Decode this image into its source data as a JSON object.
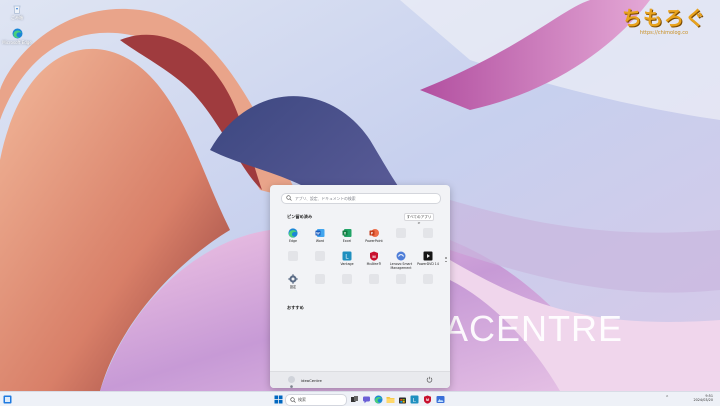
{
  "desktop": {
    "icons": [
      {
        "label": "ごみ箱",
        "icon": "recycle-bin-icon"
      },
      {
        "label": "Microsoft Edge",
        "icon": "edge-icon"
      }
    ],
    "brand_text": "ACENTRE",
    "watermark": {
      "title": "ちもろぐ",
      "url": "https://chimolog.co"
    }
  },
  "start_menu": {
    "search_placeholder": "アプリ、設定、ドキュメントの検索",
    "pinned_title": "ピン留め済み",
    "all_apps_label": "すべてのアプリ >",
    "pinned_apps": [
      {
        "label": "Edge",
        "icon": "edge-icon"
      },
      {
        "label": "Word",
        "icon": "word-icon"
      },
      {
        "label": "Excel",
        "icon": "excel-icon"
      },
      {
        "label": "PowerPoint",
        "icon": "powerpoint-icon"
      },
      {
        "label": "",
        "icon": "placeholder"
      },
      {
        "label": "",
        "icon": "placeholder"
      },
      {
        "label": "",
        "icon": "placeholder"
      },
      {
        "label": "",
        "icon": "placeholder"
      },
      {
        "label": "Vantage",
        "icon": "lenovo-vantage-icon"
      },
      {
        "label": "McAfee®",
        "icon": "mcafee-icon"
      },
      {
        "label": "Lenovo Smart Management",
        "icon": "lenovo-smart-icon"
      },
      {
        "label": "PowerDVD 14",
        "icon": "powerdvd-icon"
      },
      {
        "label": "設定",
        "icon": "settings-icon"
      },
      {
        "label": "",
        "icon": "placeholder"
      },
      {
        "label": "",
        "icon": "placeholder"
      },
      {
        "label": "",
        "icon": "placeholder"
      },
      {
        "label": "",
        "icon": "placeholder"
      },
      {
        "label": "",
        "icon": "placeholder"
      }
    ],
    "recommended_title": "おすすめ",
    "user_name": "ideaCentre"
  },
  "taskbar": {
    "search_label": "検索",
    "time": "9:51",
    "date": "2024/03/20",
    "colors": {
      "accent": "#0067c0",
      "bar": "#eef1f7"
    }
  }
}
